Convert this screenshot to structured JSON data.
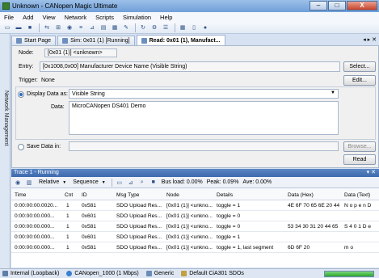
{
  "window": {
    "title": "Unknown - CANopen Magic Ultimate",
    "minimize": "–",
    "maximize": "□",
    "close": "X"
  },
  "menu": [
    "File",
    "Add",
    "View",
    "Network",
    "Scripts",
    "Simulation",
    "Help"
  ],
  "side_panel": {
    "label": "Network Management"
  },
  "tabs": [
    {
      "label": "Start Page"
    },
    {
      "label": "Sim: 0x01 (1) [Running]"
    },
    {
      "label": "Read: 0x01 (1), Manufact..."
    }
  ],
  "tab_controls": "◂ ▸ ✕",
  "read_panel": {
    "node_label": "Node:",
    "node_value": "[0x01 (1)] <unknown>",
    "entry_label": "Entry:",
    "entry_value": "[0x1008,0x00] Manufacturer Device Name (Visible String)",
    "select_button": "Select...",
    "trigger_label": "Trigger:",
    "trigger_value": "None",
    "edit_button": "Edit...",
    "display_data_label": "Display Data as:",
    "display_data_value": "Visible String",
    "data_label": "Data:",
    "data_value": "MicroCANopen DS401 Demo",
    "save_data_label": "Save Data in:",
    "browse_button": "Browse...",
    "read_button": "Read"
  },
  "trace": {
    "title": "Trace 1 - Running",
    "header_controls": "▾ ✕",
    "mode": "Relative",
    "order": "Sequence",
    "bus_load": "Bus load: 0.00%",
    "peak": "Peak: 0.09%",
    "avg": "Ave: 0.00%",
    "columns": [
      "Time",
      "Cnt",
      "ID",
      "Msg Type",
      "Node",
      "Details",
      "Data (Hex)",
      "Data (Text)"
    ],
    "rows": [
      [
        "0:00:00:00.0020...",
        "1",
        "0x581",
        "SDO Upload Res...",
        "[0x01 (1)] <unkno...",
        "toggle = 1",
        "4E 6F 70 65 6E 20 44",
        "N o p e n   D"
      ],
      [
        "0:00:00:00.000...",
        "1",
        "0x601",
        "SDO Upload Res...",
        "[0x01 (1)] <unkno...",
        "toggle = 0",
        "",
        ""
      ],
      [
        "0:00:00:00.000...",
        "1",
        "0x581",
        "SDO Upload Res...",
        "[0x01 (1)] <unkno...",
        "toggle = 0",
        "53 34 30 31 20 44 65",
        "S 4 0 1   D e"
      ],
      [
        "0:00:00:00.000...",
        "1",
        "0x601",
        "SDO Upload Res...",
        "[0x01 (1)] <unkno...",
        "toggle = 1",
        "",
        ""
      ],
      [
        "0:00:00:00.000...",
        "1",
        "0x581",
        "SDO Upload Res...",
        "[0x01 (1)] <unkno...",
        "toggle = 1, last segment",
        "6D 6F 20",
        "m o"
      ]
    ]
  },
  "status": {
    "interface": "Internal (Loopback)",
    "baud": "CANopen_1000 (1 Mbps)",
    "profile": "Generic",
    "sdos": "Default CiA301 SDOs",
    "progress_fraction": 1.0
  },
  "colors": {
    "accent": "#3c69ad",
    "progress": "#2aa62a"
  }
}
